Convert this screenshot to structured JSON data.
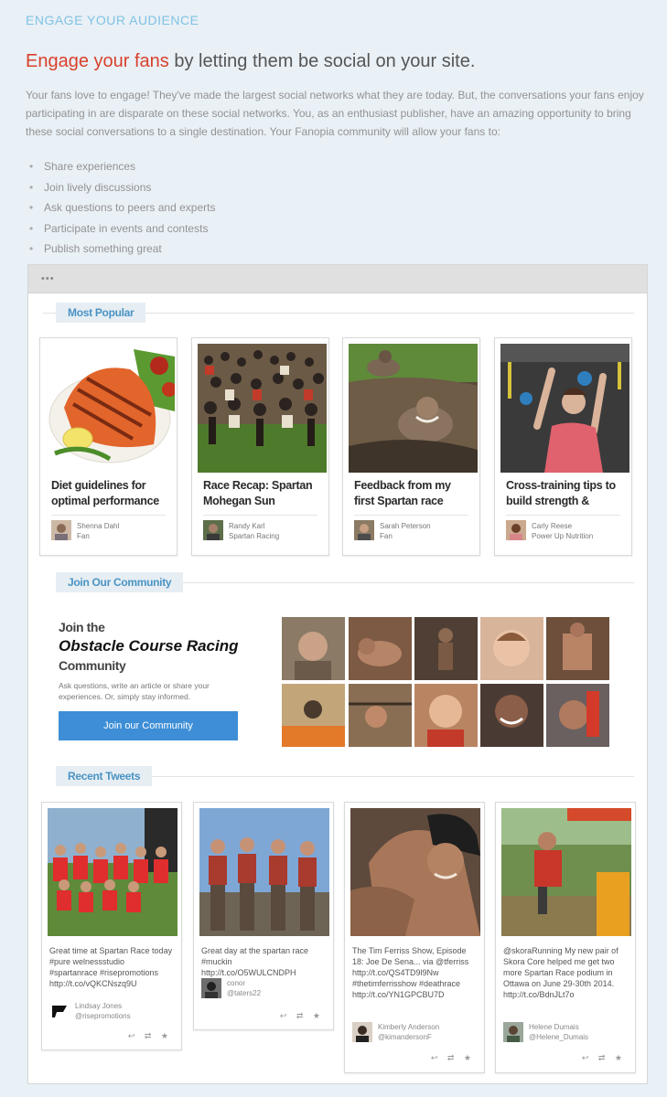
{
  "section_title": "ENGAGE YOUR AUDIENCE",
  "headline": {
    "accent": "Engage your fans",
    "rest": " by letting them be social on your site."
  },
  "intro": "Your fans love to engage! They've made the largest social networks what they are today. But, the conversations your fans enjoy participating in are disparate on these social networks. You, as an enthusiast publisher, have an amazing opportunity to bring these social conversations to a single destination. Your Fanopia community will allow your fans to:",
  "bullets": [
    "Share experiences",
    "Join lively discussions",
    "Ask questions to peers and experts",
    "Participate in events and contests",
    "Publish something great"
  ],
  "mockup": {
    "dots": "•••",
    "most_popular_label": "Most Popular",
    "popular": [
      {
        "title": "Diet guidelines for optimal performance",
        "author": "Shenna Dahl",
        "role": "Fan"
      },
      {
        "title": "Race Recap: Spartan Mohegan Sun",
        "author": "Randy Karl",
        "role": "Spartan Racing"
      },
      {
        "title": "Feedback from my first Spartan race",
        "author": "Sarah Peterson",
        "role": "Fan"
      },
      {
        "title": "Cross-training tips to build strength &",
        "author": "Carly Reese",
        "role": "Power Up Nutrition"
      }
    ],
    "join_label": "Join Our Community",
    "join_small_1": "Join the",
    "join_big": "Obstacle Course Racing",
    "join_small_2": "Community",
    "join_desc": "Ask questions, write an article or share your experiences. Or, simply stay informed.",
    "join_button": "Join our Community",
    "tweets_label": "Recent Tweets",
    "tweets": [
      {
        "text": "Great time at Spartan Race today #pure welnessstudio #spartanrace #risepromotions http://t.co/vQKCNszq9U",
        "author": "Lindsay Jones",
        "handle": "@risepromotions"
      },
      {
        "text": "Great day at the spartan race #muckin http://t.co/O5WULCNDPH",
        "author": "conor",
        "handle": "@taters22"
      },
      {
        "text": "The Tim Ferriss Show, Episode 18: Joe De Sena... via @tferriss http://t.co/QS4TD9l9Nw #thetimferrisshow #deathrace http://t.co/YN1GPCBU7D",
        "author": "Kimberly Anderson",
        "handle": "@kimandersonF"
      },
      {
        "text": "@skoraRunning My new pair of Skora Core helped me get two more Spartan Race podium in Ottawa on June 29-30th 2014. http://t.co/BdnJLt7o",
        "author": "Helene Dumais",
        "handle": "@Helene_Dumais"
      }
    ],
    "tweet_actions": "↩ ⇄ ★"
  }
}
